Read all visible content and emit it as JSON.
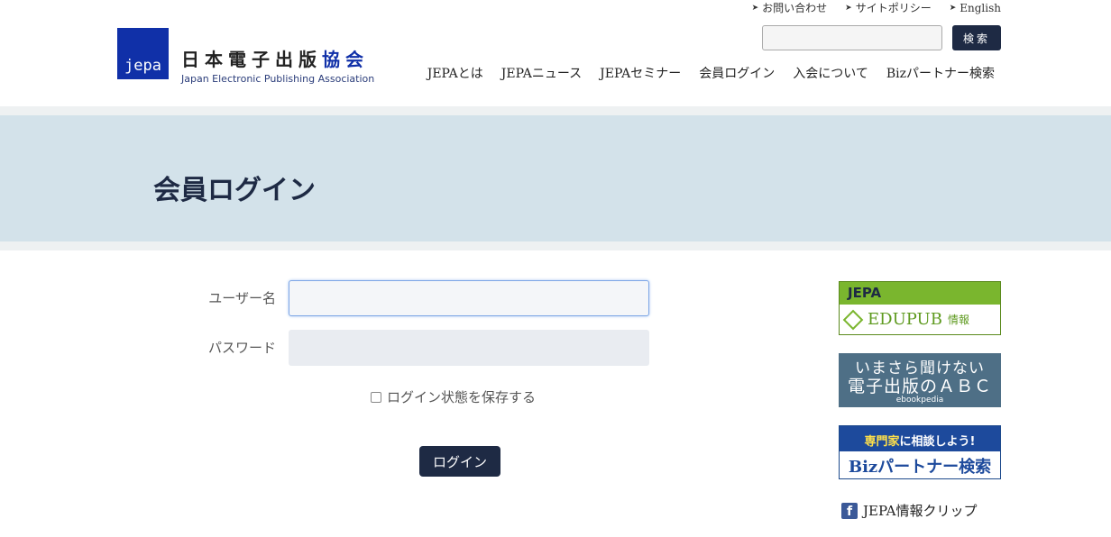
{
  "header": {
    "util_links": [
      {
        "label": "お問い合わせ"
      },
      {
        "label": "サイトポリシー"
      },
      {
        "label": "English"
      }
    ],
    "search": {
      "value": "",
      "placeholder": "",
      "button_label": "検索"
    },
    "logo": {
      "mark": "jepa",
      "name_jp_main": "日本電子出版",
      "name_jp_accent": "協会",
      "name_en": "Japan Electronic Publishing Association"
    },
    "nav": [
      {
        "label": "JEPAとは"
      },
      {
        "label": "JEPAニュース"
      },
      {
        "label": "JEPAセミナー"
      },
      {
        "label": "会員ログイン"
      },
      {
        "label": "入会について"
      },
      {
        "label": "Bizパートナー検索"
      }
    ]
  },
  "hero": {
    "title": "会員ログイン"
  },
  "login_form": {
    "username_label": "ユーザー名",
    "username_value": "",
    "password_label": "パスワード",
    "password_value": "",
    "remember_label": "ログイン状態を保存する",
    "remember_checked": false,
    "submit_label": "ログイン"
  },
  "sidebar": {
    "edupub": {
      "top": "JEPA",
      "main": "EDUPUB",
      "sub": "情報"
    },
    "abc": {
      "line1": "いまさら聞けない",
      "line2": "電子出版のＡＢＣ",
      "line3": "ebookpedia"
    },
    "biz": {
      "top_highlight": "専門家",
      "top_rest": "に相談しよう!",
      "main": "Bizパートナー検索"
    },
    "fb_clip": {
      "icon": "facebook-icon",
      "label": "JEPA情報クリップ"
    }
  },
  "colors": {
    "navy": "#1e2a44",
    "logo_blue": "#1030a8",
    "hero_bg": "#d3e2ea",
    "edupub_green": "#7ab62e",
    "biz_blue": "#1d4a9c",
    "facebook_blue": "#3b5998"
  }
}
